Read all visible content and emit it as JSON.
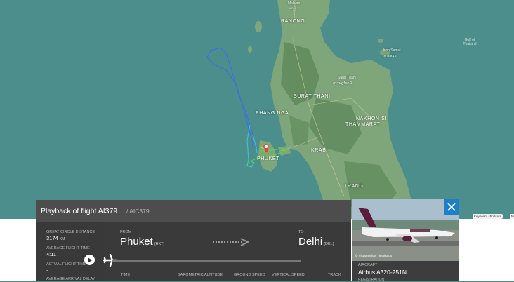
{
  "map": {
    "labels": {
      "malwan": "Malwan",
      "myanmar_text": "မလွန်",
      "ranong": "RANONG",
      "koh_samui": "Koh Samui",
      "koh_samui_thai": "เกาะสมุย",
      "surat_thani_small": "Surat Thani",
      "surat_thani_thai": "สุราษฎร์ธานี",
      "surat_thani": "SURAT THANI",
      "phang_nga": "PHANG NGA",
      "nakhon": "NAKHON SI",
      "thammarat": "THAMMARAT",
      "krabi": "KRABI",
      "phuket": "PHUKET",
      "trang": "TRANG",
      "gulf_line1": "Gulf of",
      "gulf_line2": "Thailand"
    },
    "keyboard_shortcuts": "Keyboard shortcuts",
    "keyboard_extra": "Ma"
  },
  "panel": {
    "title": "Playback of flight AI379",
    "subtitle": "/ AIC379",
    "stats": {
      "great_circle_label": "GREAT CIRCLE DISTANCE",
      "great_circle_value": "3174",
      "great_circle_unit": "KM",
      "avg_flight_time_label": "AVERAGE FLIGHT TIME",
      "avg_flight_time_value": "4:11",
      "actual_flight_time_label": "ACTUAL FLIGHT TIME",
      "actual_flight_time_value": "-",
      "avg_arrival_delay_label": "AVERAGE ARRIVAL DELAY"
    },
    "route": {
      "from_label": "FROM",
      "from_city": "Phuket",
      "from_code": "(HKT)",
      "to_label": "TO",
      "to_city": "Delhi",
      "to_code": "(DEL)"
    },
    "columns": {
      "time": "TIME",
      "baro_alt": "BAROMETRIC ALTITUDE",
      "ground_speed": "GROUND SPEED",
      "vertical_speed": "VERTICAL SPEED",
      "track": "TRACK"
    }
  },
  "aircraft": {
    "photo_credit": "© Viswanathan | jetphotos",
    "label": "AIRCRAFT",
    "value": "Airbus A320-251N",
    "registration_label": "REGISTRATION"
  },
  "colors": {
    "sea": "#4b8e8c",
    "land": "#7fa87a",
    "panel": "#3d3d3d",
    "accent": "#1d7fc4"
  }
}
